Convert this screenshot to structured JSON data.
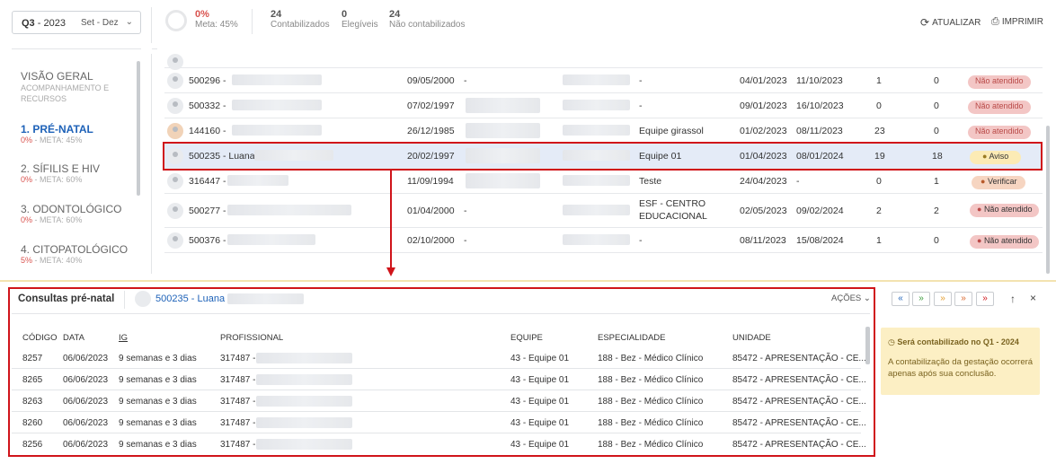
{
  "period": {
    "quarter": "Q3",
    "year": "- 2023",
    "range": "Set - Dez"
  },
  "stats": {
    "percent": "0%",
    "meta": "Meta: 45%",
    "contabilizados_n": "24",
    "contabilizados_l": "Contabilizados",
    "elegiveis_n": "0",
    "elegiveis_l": "Elegíveis",
    "nao_n": "24",
    "nao_l": "Não contabilizados"
  },
  "actions": {
    "atualizar": "ATUALIZAR",
    "imprimir": "IMPRIMIR"
  },
  "sidebar": [
    {
      "title": "VISÃO GERAL",
      "sub": "ACOMPANHAMENTO E RECURSOS"
    },
    {
      "title": "1. PRÉ-NATAL",
      "sub_red": "0%",
      "sub": " - META: 45%"
    },
    {
      "title": "2. SÍFILIS E HIV",
      "sub_red": "0%",
      "sub": " - META: 60%"
    },
    {
      "title": "3. ODONTOLÓGICO",
      "sub_red": "0%",
      "sub": " - META: 60%"
    },
    {
      "title": "4. CITOPATOLÓGICO",
      "sub_red": "5%",
      "sub": " - META: 40%"
    }
  ],
  "rows": [
    {
      "id": "500296 -",
      "dob": "09/05/2000",
      "c1": "-",
      "team": "-",
      "d1": "04/01/2023",
      "d2": "11/10/2023",
      "n1": "1",
      "n2": "0",
      "status": "Não atendido"
    },
    {
      "id": "500332 -",
      "dob": "07/02/1997",
      "c1": "",
      "team": "-",
      "d1": "09/01/2023",
      "d2": "16/10/2023",
      "n1": "0",
      "n2": "0",
      "status": "Não atendido"
    },
    {
      "id": "144160 -",
      "dob": "26/12/1985",
      "c1": "",
      "team": "Equipe girassol",
      "d1": "01/02/2023",
      "d2": "08/11/2023",
      "n1": "23",
      "n2": "0",
      "status": "Não atendido"
    },
    {
      "id": "500235 - Luana",
      "dob": "20/02/1997",
      "c1": "",
      "team": "Equipe 01",
      "d1": "01/04/2023",
      "d2": "08/01/2024",
      "n1": "19",
      "n2": "18",
      "status": "Aviso"
    },
    {
      "id": "316447 -",
      "dob": "11/09/1994",
      "c1": "",
      "team": "Teste",
      "d1": "24/04/2023",
      "d2": "-",
      "n1": "0",
      "n2": "1",
      "status": "Verificar"
    },
    {
      "id": "500277 -",
      "dob": "01/04/2000",
      "c1": "-",
      "team": "ESF - CENTRO",
      "team2": "EDUCACIONAL",
      "d1": "02/05/2023",
      "d2": "09/02/2024",
      "n1": "2",
      "n2": "2",
      "status": "Não atendido"
    },
    {
      "id": "500376 -",
      "dob": "02/10/2000",
      "c1": "-",
      "team": "-",
      "d1": "08/11/2023",
      "d2": "15/08/2024",
      "n1": "1",
      "n2": "0",
      "status": "Não atendido"
    }
  ],
  "detail": {
    "title": "Consultas pré-natal",
    "patient": "500235 - Luana",
    "acoes": "AÇÕES",
    "headers": [
      "CÓDIGO",
      "DATA",
      "IG",
      "PROFISSIONAL",
      "EQUIPE",
      "ESPECIALIDADE",
      "UNIDADE"
    ],
    "rows": [
      {
        "cod": "8257",
        "data": "06/06/2023",
        "ig": "9 semanas e 3 dias",
        "prof": "317487 -",
        "equipe": "43 - Equipe 01",
        "esp": "188 - Bez - Médico Clínico",
        "un": "85472 - APRESENTAÇÃO - CE..."
      },
      {
        "cod": "8265",
        "data": "06/06/2023",
        "ig": "9 semanas e 3 dias",
        "prof": "317487 -",
        "equipe": "43 - Equipe 01",
        "esp": "188 - Bez - Médico Clínico",
        "un": "85472 - APRESENTAÇÃO - CE..."
      },
      {
        "cod": "8263",
        "data": "06/06/2023",
        "ig": "9 semanas e 3 dias",
        "prof": "317487 -",
        "equipe": "43 - Equipe 01",
        "esp": "188 - Bez - Médico Clínico",
        "un": "85472 - APRESENTAÇÃO - CE..."
      },
      {
        "cod": "8260",
        "data": "06/06/2023",
        "ig": "9 semanas e 3 dias",
        "prof": "317487 -",
        "equipe": "43 - Equipe 01",
        "esp": "188 - Bez - Médico Clínico",
        "un": "85472 - APRESENTAÇÃO - CE..."
      },
      {
        "cod": "8256",
        "data": "06/06/2023",
        "ig": "9 semanas e 3 dias",
        "prof": "317487 -",
        "equipe": "43 - Equipe 01",
        "esp": "188 - Bez - Médico Clínico",
        "un": "85472 - APRESENTAÇÃO - CE..."
      }
    ]
  },
  "notice": {
    "title": "Será contabilizado no Q1 - 2024",
    "body": "A contabilização da gestação ocorrerá apenas após sua conclusão."
  },
  "colors": {
    "accent": "#1e62b8",
    "highlight": "#d0141a",
    "notice_bg": "#fcefc4"
  }
}
